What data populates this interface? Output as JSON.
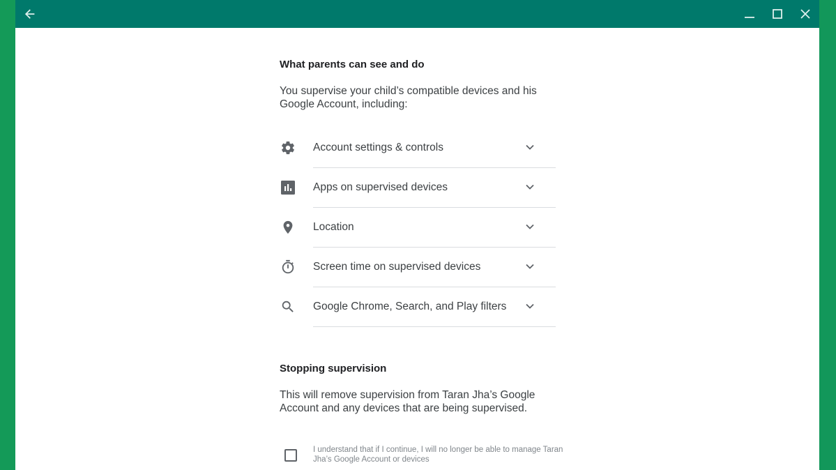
{
  "titlebar": {
    "back_icon": "arrow-left-icon",
    "minimize_icon": "minimize-icon",
    "maximize_icon": "maximize-icon",
    "close_icon": "close-icon"
  },
  "colors": {
    "titlebar": "#00796b",
    "desktop": "#149a58",
    "text_primary": "#202124",
    "text_secondary": "#3c4043",
    "icon": "#5f6368",
    "divider": "#dadce0"
  },
  "section1": {
    "title": "What parents can see and do",
    "description": "You supervise your child’s compatible devices and his Google Account, including:",
    "items": [
      {
        "icon": "gear-icon",
        "label": "Account settings & controls"
      },
      {
        "icon": "bar-chart-icon",
        "label": "Apps on supervised devices"
      },
      {
        "icon": "location-pin-icon",
        "label": "Location"
      },
      {
        "icon": "timer-icon",
        "label": "Screen time on supervised devices"
      },
      {
        "icon": "search-icon",
        "label": "Google Chrome, Search, and Play filters"
      }
    ]
  },
  "section2": {
    "title": "Stopping supervision",
    "description": "This will remove supervision from Taran Jha’s Google Account and any devices that are being supervised.",
    "checkbox_label": "I understand that if I continue, I will no longer be able to manage Taran Jha’s Google Account or devices",
    "checkbox_checked": false
  }
}
